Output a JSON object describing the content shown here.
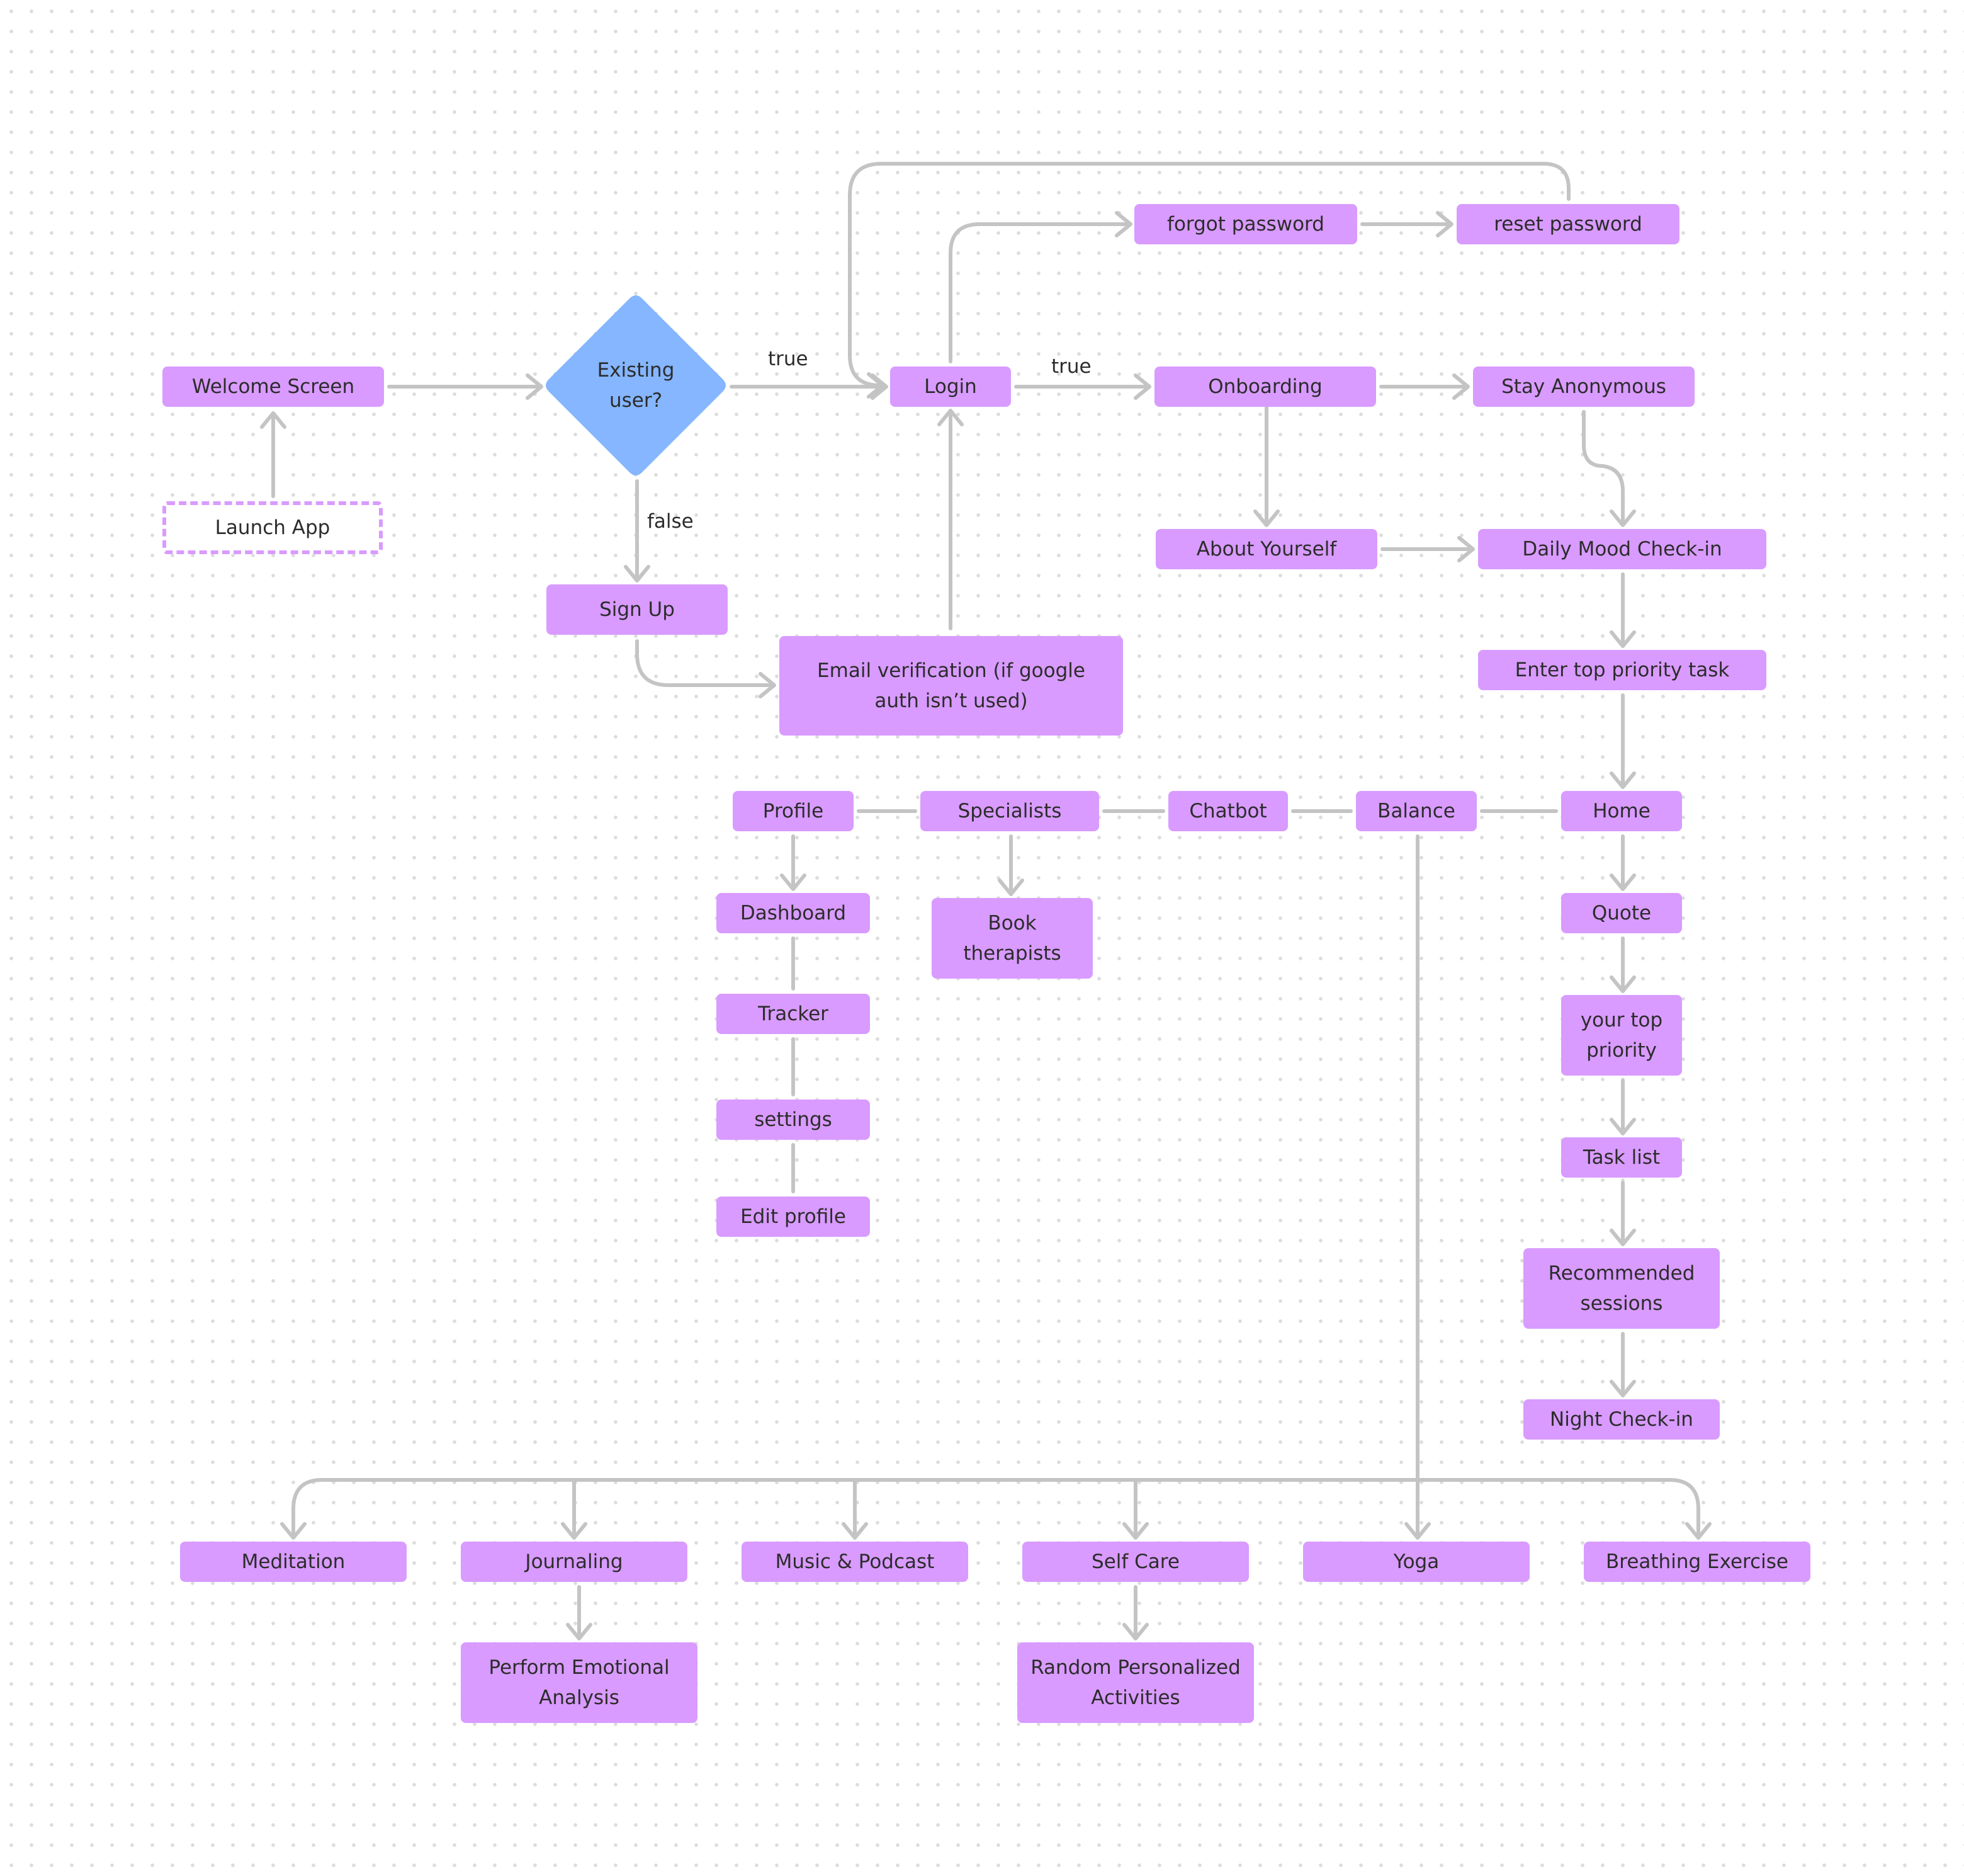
{
  "diagram": {
    "colors": {
      "process_node": "#d99bff",
      "decision_node": "#85b6ff",
      "connector": "#c4c4c4",
      "text": "#2c2c2c"
    },
    "nodes": {
      "launch_app": "Launch App",
      "welcome_screen": "Welcome Screen",
      "existing_user": "Existing user?",
      "login": "Login",
      "forgot_password": "forgot password",
      "reset_password": "reset password",
      "onboarding": "Onboarding",
      "stay_anonymous": "Stay Anonymous",
      "sign_up": "Sign Up",
      "email_verification": "Email verification (if google auth isn’t used)",
      "about_yourself": "About Yourself",
      "daily_mood_checkin": "Daily Mood Check-in",
      "enter_top_priority_task": "Enter top priority task",
      "home": "Home",
      "balance": "Balance",
      "chatbot": "Chatbot",
      "specialists": "Specialists",
      "profile": "Profile",
      "dashboard": "Dashboard",
      "book_therapists": "Book therapists",
      "tracker": "Tracker",
      "settings": "settings",
      "edit_profile": "Edit profile",
      "quote": "Quote",
      "your_top_priority": "your top priority",
      "task_list": "Task list",
      "recommended_sessions": "Recommended sessions",
      "night_checkin": "Night Check-in",
      "meditation": "Meditation",
      "journaling": "Journaling",
      "music_podcast": "Music & Podcast",
      "self_care": "Self Care",
      "yoga": "Yoga",
      "breathing_exercise": "Breathing Exercise",
      "perform_emotional_analysis": "Perform Emotional Analysis",
      "random_personalized_activities": "Random Personalized Activities"
    },
    "edge_labels": {
      "decision_true": "true",
      "decision_false": "false",
      "login_true": "true"
    },
    "edges": [
      {
        "from": "launch_app",
        "to": "welcome_screen"
      },
      {
        "from": "welcome_screen",
        "to": "existing_user"
      },
      {
        "from": "existing_user",
        "to": "login",
        "label": "true"
      },
      {
        "from": "existing_user",
        "to": "sign_up",
        "label": "false"
      },
      {
        "from": "sign_up",
        "to": "email_verification"
      },
      {
        "from": "email_verification",
        "to": "login"
      },
      {
        "from": "login",
        "to": "forgot_password"
      },
      {
        "from": "forgot_password",
        "to": "reset_password"
      },
      {
        "from": "reset_password",
        "to": "login"
      },
      {
        "from": "login",
        "to": "onboarding",
        "label": "true"
      },
      {
        "from": "onboarding",
        "to": "stay_anonymous"
      },
      {
        "from": "onboarding",
        "to": "about_yourself"
      },
      {
        "from": "about_yourself",
        "to": "daily_mood_checkin"
      },
      {
        "from": "stay_anonymous",
        "to": "daily_mood_checkin"
      },
      {
        "from": "daily_mood_checkin",
        "to": "enter_top_priority_task"
      },
      {
        "from": "enter_top_priority_task",
        "to": "home"
      },
      {
        "from": "home",
        "to": "balance",
        "undirected": true
      },
      {
        "from": "balance",
        "to": "chatbot",
        "undirected": true
      },
      {
        "from": "chatbot",
        "to": "specialists",
        "undirected": true
      },
      {
        "from": "specialists",
        "to": "profile",
        "undirected": true
      },
      {
        "from": "profile",
        "to": "dashboard"
      },
      {
        "from": "dashboard",
        "to": "tracker",
        "undirected": true
      },
      {
        "from": "tracker",
        "to": "settings",
        "undirected": true
      },
      {
        "from": "settings",
        "to": "edit_profile",
        "undirected": true
      },
      {
        "from": "specialists",
        "to": "book_therapists"
      },
      {
        "from": "home",
        "to": "quote"
      },
      {
        "from": "quote",
        "to": "your_top_priority"
      },
      {
        "from": "your_top_priority",
        "to": "task_list"
      },
      {
        "from": "task_list",
        "to": "recommended_sessions"
      },
      {
        "from": "recommended_sessions",
        "to": "night_checkin"
      },
      {
        "from": "balance",
        "to": "meditation"
      },
      {
        "from": "balance",
        "to": "journaling"
      },
      {
        "from": "balance",
        "to": "music_podcast"
      },
      {
        "from": "balance",
        "to": "self_care"
      },
      {
        "from": "balance",
        "to": "yoga"
      },
      {
        "from": "balance",
        "to": "breathing_exercise"
      },
      {
        "from": "journaling",
        "to": "perform_emotional_analysis"
      },
      {
        "from": "self_care",
        "to": "random_personalized_activities"
      }
    ]
  }
}
